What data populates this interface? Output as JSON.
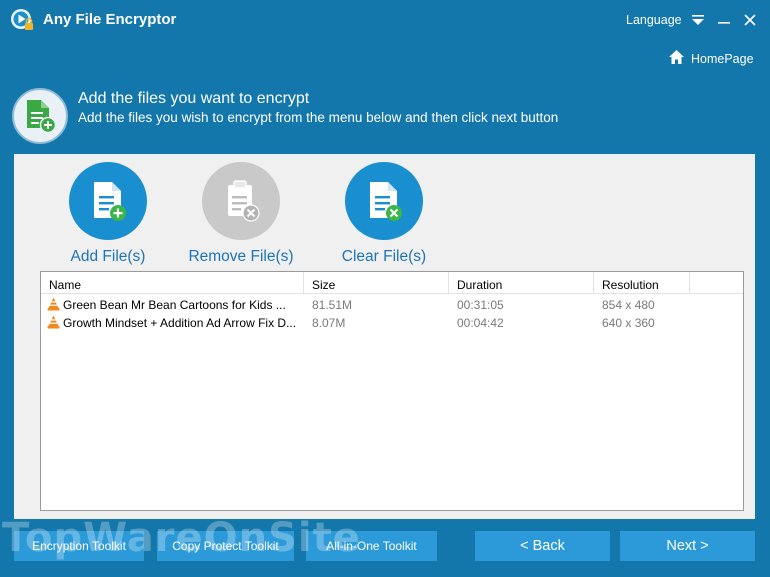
{
  "titlebar": {
    "title": "Any File Encryptor",
    "language_label": "Language"
  },
  "header": {
    "homepage_label": "HomePage",
    "step_title": "Add the files you want to encrypt",
    "step_subtitle": "Add the files you wish to encrypt from the menu below and then click next button"
  },
  "toolbar": {
    "add_label": "Add File(s)",
    "remove_label": "Remove File(s)",
    "clear_label": "Clear File(s)"
  },
  "table": {
    "columns": [
      "Name",
      "Size",
      "Duration",
      "Resolution"
    ],
    "rows": [
      {
        "name": "Green Bean   Mr Bean   Cartoons for Kids   ...",
        "size": "81.51M",
        "duration": "00:31:05",
        "resolution": "854 x 480"
      },
      {
        "name": "Growth Mindset + Addition Ad Arrow Fix D...",
        "size": "8.07M",
        "duration": "00:04:42",
        "resolution": "640 x 360"
      }
    ]
  },
  "footer": {
    "encryption_toolkit": "Encryption Toolkit",
    "copy_protect_toolkit": "Copy Protect Toolkit",
    "all_in_one_toolkit": "All-in-One Toolkit",
    "back_label": "< Back",
    "next_label": "Next >"
  },
  "watermark": "TopWareOnSite",
  "colors": {
    "background": "#1377ab",
    "accent": "#1a8fd0",
    "button": "#2c9ad9",
    "panel": "#f0f0f0"
  }
}
